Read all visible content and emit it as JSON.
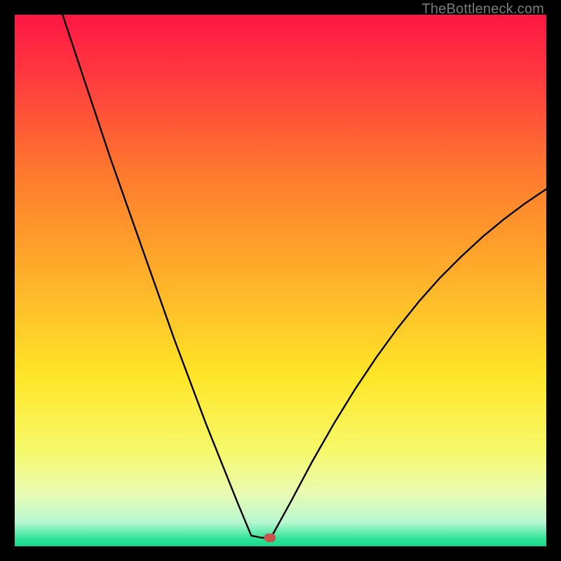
{
  "watermark": "TheBottleneck.com",
  "chart_data": {
    "type": "line",
    "title": "",
    "xlabel": "",
    "ylabel": "",
    "xlim": [
      0,
      100
    ],
    "ylim": [
      0,
      100
    ],
    "grid": false,
    "legend": false,
    "background": {
      "type": "vertical-gradient",
      "stops": [
        {
          "pos": 0.0,
          "color": "#ff1744"
        },
        {
          "pos": 0.12,
          "color": "#ff3b3f"
        },
        {
          "pos": 0.3,
          "color": "#ff7a2e"
        },
        {
          "pos": 0.5,
          "color": "#ffb22a"
        },
        {
          "pos": 0.68,
          "color": "#ffe628"
        },
        {
          "pos": 0.82,
          "color": "#f6f96a"
        },
        {
          "pos": 0.9,
          "color": "#e9fbb2"
        },
        {
          "pos": 0.955,
          "color": "#b7f7d0"
        },
        {
          "pos": 0.985,
          "color": "#34e39a"
        },
        {
          "pos": 1.0,
          "color": "#15d98a"
        }
      ]
    },
    "series": [
      {
        "name": "left-branch",
        "stroke": "#000000",
        "width": 2.4,
        "x": [
          9.0,
          12,
          15,
          18,
          21,
          24,
          27,
          30,
          33,
          36,
          39,
          42,
          44.5
        ],
        "y": [
          100,
          91,
          82,
          73,
          64.5,
          56,
          47.5,
          39,
          31,
          23,
          15.5,
          8,
          2.0
        ]
      },
      {
        "name": "valley-flat",
        "stroke": "#000000",
        "width": 2.4,
        "x": [
          44.5,
          46.5,
          48.2
        ],
        "y": [
          2.0,
          1.6,
          1.6
        ]
      },
      {
        "name": "right-branch",
        "stroke": "#000000",
        "width": 2.4,
        "x": [
          48.2,
          52,
          56,
          60,
          64,
          68,
          72,
          76,
          80,
          84,
          88,
          92,
          96,
          100
        ],
        "y": [
          1.6,
          8.5,
          16,
          23,
          29.5,
          35.5,
          41,
          46,
          50.5,
          54.5,
          58.2,
          61.5,
          64.5,
          67.2
        ]
      }
    ],
    "marker": {
      "name": "valley-marker",
      "shape": "rounded-rect",
      "x": 48.0,
      "y": 1.6,
      "w": 2.2,
      "h": 1.6,
      "fill": "#c9534a"
    }
  }
}
